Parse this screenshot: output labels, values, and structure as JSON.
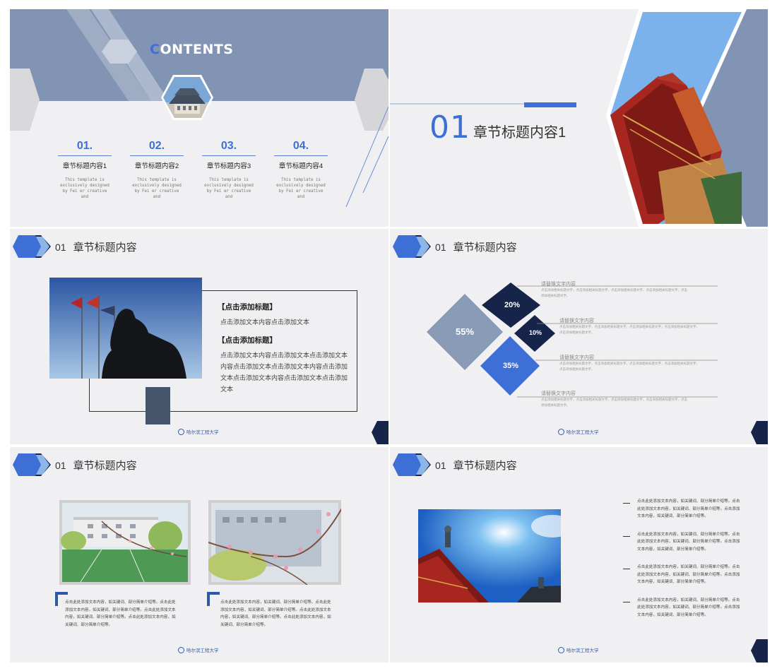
{
  "slide1": {
    "title_first": "C",
    "title_rest": "ONTENTS",
    "items": [
      {
        "num": "01.",
        "title": "章节标题内容1",
        "desc": "This template is exclusively designed by Fei er creative and"
      },
      {
        "num": "02.",
        "title": "章节标题内容2",
        "desc": "This template is exclusively designed by Fei er creative and"
      },
      {
        "num": "03.",
        "title": "章节标题内容3",
        "desc": "This template is exclusively designed by Fei er creative and"
      },
      {
        "num": "04.",
        "title": "章节标题内容4",
        "desc": "This template is exclusively designed by Fei er creative and"
      }
    ]
  },
  "slide2": {
    "number": "01",
    "title": "章节标题内容1"
  },
  "section": {
    "number": "01",
    "title": "章节标题内容"
  },
  "slide3": {
    "heading1": "【点击添加标题】",
    "body1": "点击添加文本内容点击添加文本",
    "heading2": "【点击添加标题】",
    "body2": "点击添加文本内容点击添加文本点击添加文本内容点击添加文本点击添加文本内容点击添加文本点击添加文本内容点击添加文本点击添加文本"
  },
  "slide4": {
    "diamonds": [
      "55%",
      "20%",
      "10%",
      "35%"
    ],
    "points": [
      {
        "title": "请替换文字内容",
        "desc": "点击添加相关标题文字，点击添加相关标题文字，点击添加相关标题文字，点击添加相关标题文字，点击添加相关标题文字。"
      },
      {
        "title": "请替换文字内容",
        "desc": "点击添加相关标题文字，点击添加相关标题文字，点击添加相关标题文字，点击添加相关标题文字，点击添加相关标题文字。"
      },
      {
        "title": "请替换文字内容",
        "desc": "点击添加相关标题文字，点击添加相关标题文字，点击添加相关标题文字，点击添加相关标题文字，点击添加相关标题文字。"
      },
      {
        "title": "请替换文字内容",
        "desc": "点击添加相关标题文字，点击添加相关标题文字，点击添加相关标题文字，点击添加相关标题文字，点击添加相关标题文字。"
      }
    ]
  },
  "slide5": {
    "captions": [
      "点击此处添加文本内容，如关键词、部分简单介绍等。点击此处添加文本内容，如关键词、部分简单介绍等。点击此处添加文本内容，如关键词、部分简单介绍等。点击此处添加文本内容，如关键词、部分简单介绍等。",
      "点击此处添加文本内容，如关键词、部分简单介绍等。点击此处添加文本内容，如关键词、部分简单介绍等。点击此处添加文本内容，如关键词、部分简单介绍等。点击此处添加文本内容，如关键词、部分简单介绍等。"
    ]
  },
  "slide6": {
    "bullets": [
      "点击此处添加文本内容，如关键词、部分简单介绍等。点击此处添加文本内容，如关键词、部分简单介绍等。点击添加文本内容，如关键词、部分简单介绍等。",
      "点击此处添加文本内容，如关键词、部分简单介绍等。点击此处添加文本内容，如关键词、部分简单介绍等。点击添加文本内容，如关键词、部分简单介绍等。",
      "点击此处添加文本内容，如关键词、部分简单介绍等。点击此处添加文本内容，如关键词、部分简单介绍等。点击添加文本内容，如关键词、部分简单介绍等。",
      "点击此处添加文本内容，如关键词、部分简单介绍等。点击此处添加文本内容，如关键词、部分简单介绍等。点击添加文本内容，如关键词、部分简单介绍等。"
    ]
  },
  "colors": {
    "accent": "#3d6fd6",
    "navy": "#16244a",
    "slate": "#8294b3",
    "dark_block": "#44546a"
  }
}
